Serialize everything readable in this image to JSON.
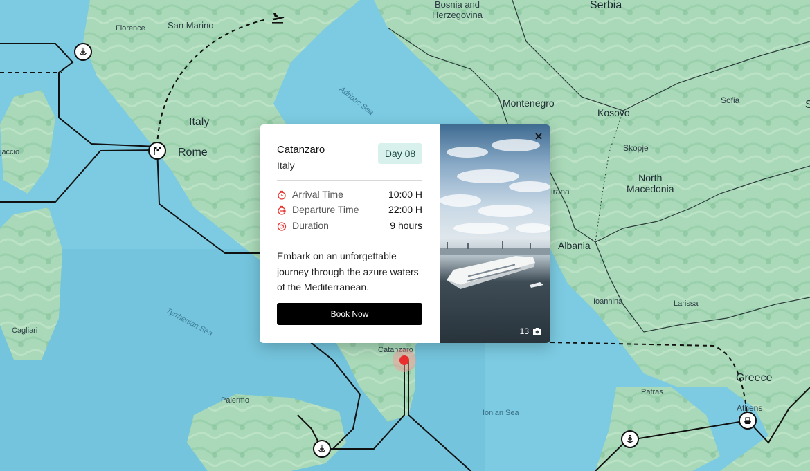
{
  "map": {
    "labels": {
      "bosnia": "Bosnia and\nHerzegovina",
      "serbia": "Serbia",
      "florence": "Florence",
      "san_marino": "San Marino",
      "italy": "Italy",
      "rome": "Rome",
      "adriatic_sea": "Adriatic Sea",
      "montenegro": "Montenegro",
      "kosovo": "Kosovo",
      "sofia": "Sofia",
      "skopje": "Skopje",
      "north_macedonia": "North\nMacedonia",
      "tirana": "irana",
      "albania": "Albania",
      "ioannina": "Ioannina",
      "larissa": "Larissa",
      "greece": "Greece",
      "patras": "Patras",
      "athens": "Athens",
      "ajaccio": "jaccio",
      "cagliari": "Cagliari",
      "tyrrhenian_sea": "Tyrrhenian Sea",
      "palermo": "Palermo",
      "ionian_sea": "Ionian Sea",
      "catanzaro": "Catanzaro",
      "sofia_edge": "S"
    }
  },
  "popup": {
    "port_name": "Catanzaro",
    "country": "Italy",
    "day_badge": "Day 08",
    "details": [
      {
        "label": "Arrival Time",
        "value": "10:00 H",
        "icon": "clock-arrival-icon"
      },
      {
        "label": "Departure Time",
        "value": "22:00 H",
        "icon": "clock-departure-icon"
      },
      {
        "label": "Duration",
        "value": "9 hours",
        "icon": "duration-icon"
      }
    ],
    "description": "Embark on an unforgettable journey through the azure waters of the Mediterranean.",
    "book_label": "Book Now",
    "photo_count": "13"
  },
  "colors": {
    "accent_red": "#e53935",
    "badge_bg": "#d9f1ec",
    "button_bg": "#000000"
  }
}
